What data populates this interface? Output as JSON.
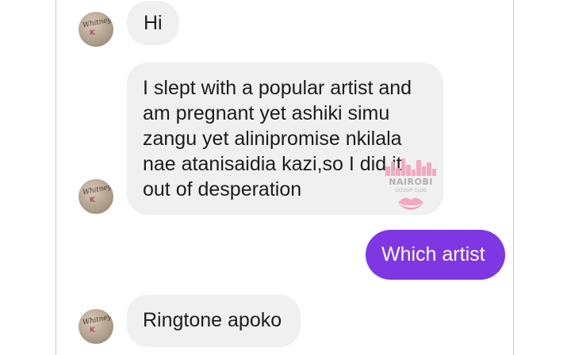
{
  "thread": {
    "messages": [
      {
        "side": "incoming",
        "lines": [
          "Hi"
        ]
      },
      {
        "side": "incoming",
        "lines": [
          "I slept with a popular artist and",
          "am pregnant yet ashiki simu",
          "zangu yet alinipromise nkilala",
          "nae atanisaidia kazi,so I did it",
          "out of desperation"
        ]
      },
      {
        "side": "outgoing",
        "lines": [
          "Which artist"
        ]
      },
      {
        "side": "incoming",
        "lines": [
          "Ringtone apoko"
        ]
      }
    ]
  },
  "avatar": {
    "script": "Whitney",
    "mark": "K"
  },
  "watermark": {
    "title": "NAIROBI",
    "subtitle": "GOSSIP CLUB"
  },
  "colors": {
    "incoming_bubble": "#f1f0f0",
    "outgoing_bubble": "#7f36e3",
    "frame_border": "#e7b8cf",
    "watermark_pink": "#f3a3bd"
  }
}
